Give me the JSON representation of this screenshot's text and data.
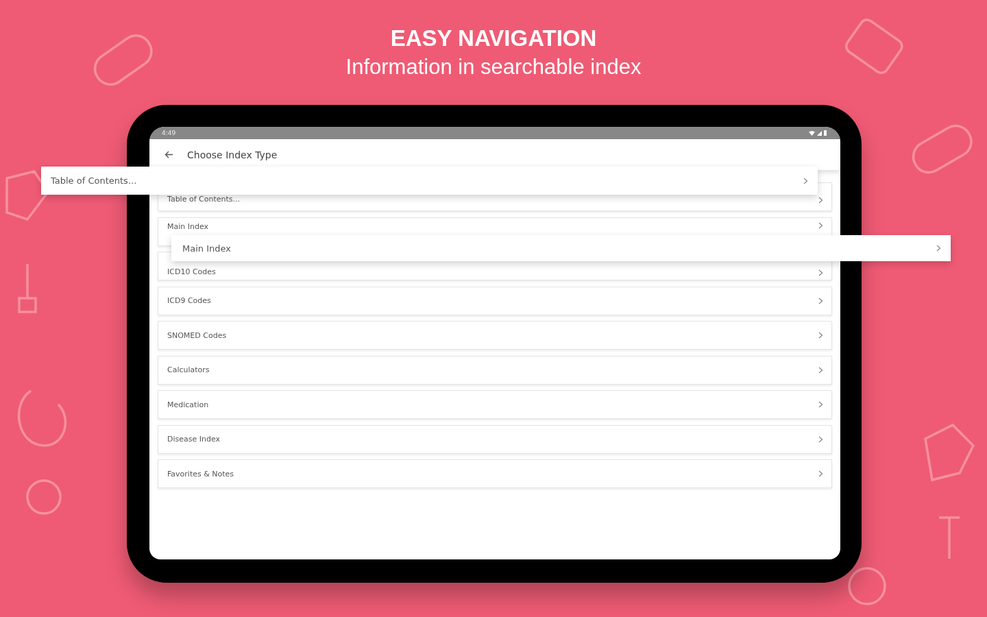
{
  "banner": {
    "title": "EASY NAVIGATION",
    "subtitle": "Information in searchable index"
  },
  "status_bar": {
    "time": "4:49"
  },
  "toolbar": {
    "title": "Choose Index Type"
  },
  "index_types": [
    {
      "label": "Table of Contents..."
    },
    {
      "label": "Main Index"
    },
    {
      "label": "ICD10 Codes"
    },
    {
      "label": "ICD9 Codes"
    },
    {
      "label": "SNOMED Codes"
    },
    {
      "label": "Calculators"
    },
    {
      "label": "Medication"
    },
    {
      "label": "Disease Index"
    },
    {
      "label": "Favorites & Notes"
    }
  ],
  "callouts": [
    {
      "label": "Table of Contents..."
    },
    {
      "label": "Main Index"
    }
  ]
}
